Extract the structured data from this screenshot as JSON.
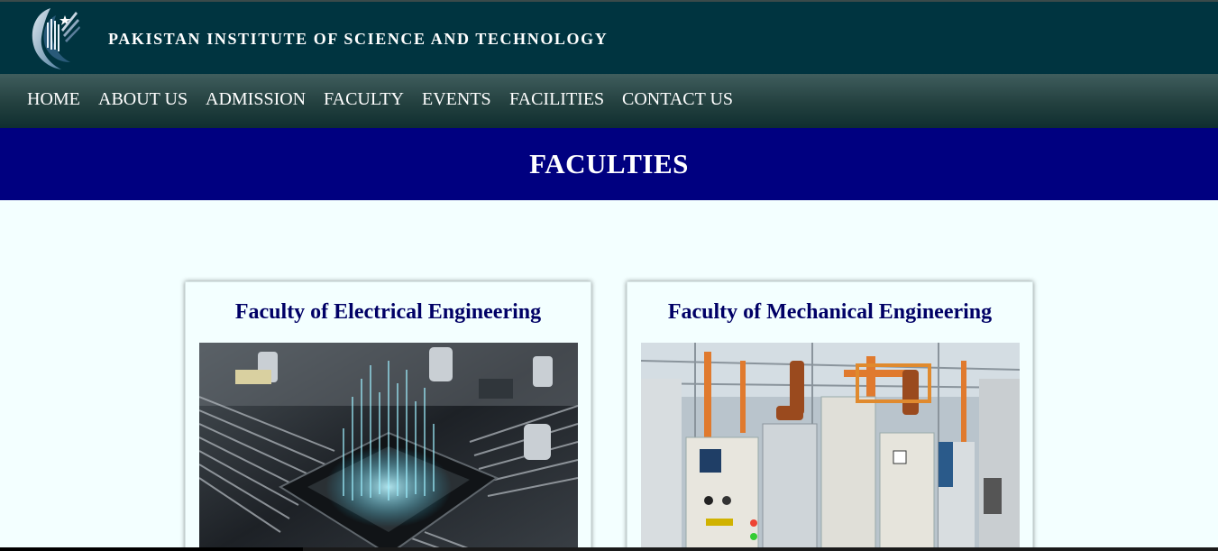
{
  "header": {
    "site_title": "PAKISTAN INSTITUTE OF SCIENCE AND TECHNOLOGY",
    "logo_icon": "university-crescent-logo-icon"
  },
  "nav": {
    "items": [
      {
        "label": "HOME"
      },
      {
        "label": "ABOUT US"
      },
      {
        "label": "ADMISSION"
      },
      {
        "label": "FACULTY"
      },
      {
        "label": "EVENTS"
      },
      {
        "label": "FACILITIES"
      },
      {
        "label": "CONTACT US"
      }
    ]
  },
  "banner": {
    "title": "FACULTIES"
  },
  "faculties": [
    {
      "title": "Faculty of Electrical Engineering",
      "image": "circuit-board-chip-image"
    },
    {
      "title": "Faculty of Mechanical Engineering",
      "image": "factory-assembly-line-image"
    }
  ],
  "colors": {
    "header_bg": "#003440",
    "nav_bg": "#23403f",
    "banner_bg": "#000080",
    "page_bg": "#f3ffff",
    "card_title": "#000066"
  }
}
